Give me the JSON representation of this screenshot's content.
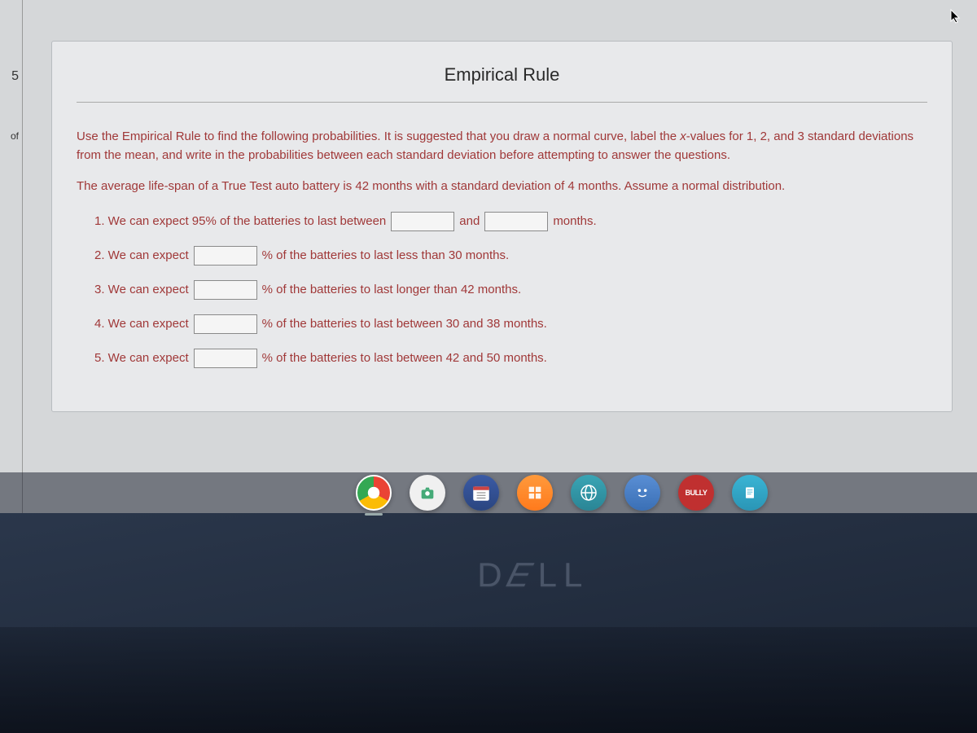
{
  "sidebar": {
    "number": "5",
    "label": "of"
  },
  "quiz": {
    "title": "Empirical Rule",
    "instruction_part1": "Use the Empirical Rule to find the following probabilities. It is suggested that you draw a normal curve, label the ",
    "instruction_x": "x",
    "instruction_part2": "-values for 1, 2, and 3 standard deviations from the mean, and write in the probabilities between each standard deviation before attempting to answer the questions.",
    "context": "The average life-span of a True Test auto battery is 42 months with a standard deviation of 4 months. Assume a normal distribution.",
    "questions": {
      "q1": {
        "pre": "1. We can expect 95% of the batteries to last between",
        "mid": "and",
        "post": "months."
      },
      "q2": {
        "pre": "2. We can expect",
        "post": "% of the batteries to last less than 30 months."
      },
      "q3": {
        "pre": "3. We can expect",
        "post": "% of the batteries to last longer than 42 months."
      },
      "q4": {
        "pre": "4. We can expect",
        "post": "% of the batteries to last between 30 and 38 months."
      },
      "q5": {
        "pre": "5. We can expect",
        "post": "% of the batteries to last between 42 and 50 months."
      }
    }
  },
  "taskbar": {
    "bully_label": "BULLY"
  },
  "brand": "DELL"
}
